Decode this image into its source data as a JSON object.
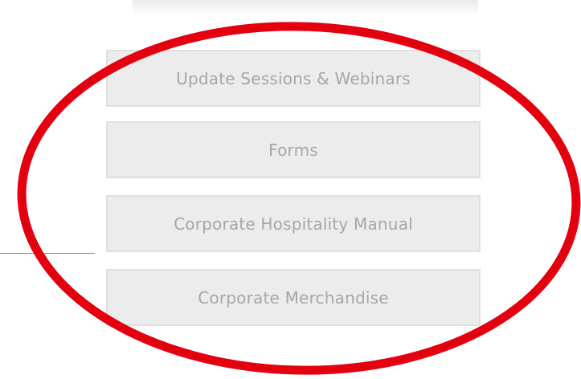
{
  "menu": {
    "buttons": [
      {
        "label": "Update Sessions & Webinars"
      },
      {
        "label": "Forms"
      },
      {
        "label": "Corporate Hospitality Manual"
      },
      {
        "label": "Corporate Merchandise"
      }
    ]
  },
  "annotation": {
    "shape": "ellipse",
    "color": "#e3000f"
  },
  "colors": {
    "button_background": "#ececec",
    "button_border": "#e0e0e0",
    "button_text": "#a7a7a7",
    "divider": "#8c8c8c"
  }
}
